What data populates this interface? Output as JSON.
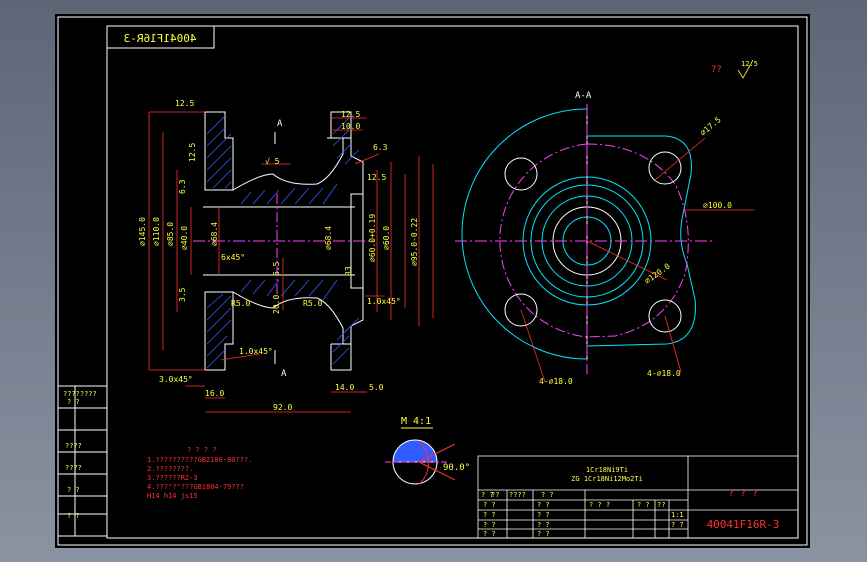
{
  "drawing": {
    "stamp_mirrored": "40041F16R-3",
    "question_marks_top": "??",
    "roughness_top": "12.5",
    "section_label": "A-A",
    "cut_label_top": "A",
    "cut_label_bottom": "A",
    "detail_label": "M 4:1",
    "detail_angle": "90.0°",
    "drawing_number": "40041F16R-3",
    "title_question": "? ? ?",
    "material_line1": "1Cr18Ni9Ti",
    "material_line2": "ZG 1Cr18Ni12Mo2Ti",
    "scale": "1:1"
  },
  "dimensions": {
    "left_vertical": [
      "⌀145.0",
      "⌀110.0",
      "⌀85.0",
      "⌀40.0"
    ],
    "inner_vertical": [
      "⌀68.4",
      "⌀68.4",
      "⌀60.0+0.19",
      "⌀60.0",
      "⌀95.0-0.22"
    ],
    "mid_vertical": [
      "6.5",
      "20.0",
      "R3"
    ],
    "top_horizontal": [
      "12.5",
      "10.0"
    ],
    "bottom_horizontal": [
      "3.0x45°",
      "16.0",
      "92.0",
      "14.0",
      "5.0"
    ],
    "radii": [
      "R5.0",
      "R5.0",
      "R20.0"
    ],
    "chamfers": [
      "1.0x45°",
      "1.0x45°",
      "6x45°"
    ],
    "misc": [
      "12.5",
      "12.5",
      "6.3",
      "6.3",
      "12.5",
      "√ 5",
      "3.5"
    ],
    "plan_view": [
      "⌀17.5",
      "⌀100.0",
      "⌀120.0",
      "4-⌀18.0",
      "4-⌀18.0"
    ]
  },
  "notes": {
    "heading": "? ? ? ?",
    "lines": [
      "1.??????????GB2100-80???.",
      "2.????????.",
      "3.??????R2-3",
      "4.???\"?\"???GB1804-79???",
      "  H14  h14  js15"
    ]
  },
  "left_strip": {
    "rows": [
      "????????",
      "?   ?",
      "????",
      "????",
      "?   ?",
      "?   ?"
    ]
  },
  "title_block": {
    "small_row": [
      "? ?",
      "??",
      "????",
      "? ?"
    ],
    "left_rows": [
      "? ?",
      "? ?",
      "? ?",
      "? ?"
    ],
    "mid_rows": [
      "? ?",
      "? ?",
      "? ?",
      "? ?"
    ],
    "right_small": [
      "? ? ?",
      "? ?",
      "??",
      "1:1",
      "? ?"
    ]
  },
  "colors": {
    "background": "#000000",
    "outline": "#ffffff",
    "dimension": "#ff3030",
    "hatch": "#2f5bff",
    "centerline": "#ff40ff",
    "hidden": "#00e5ff",
    "text_yellow": "#ffff40",
    "frame": "#ffffff"
  }
}
